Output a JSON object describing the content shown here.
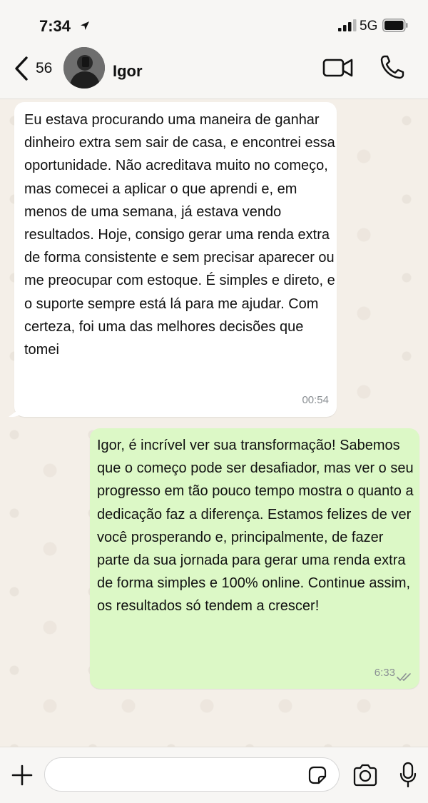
{
  "status_bar": {
    "time": "7:34",
    "network": "5G",
    "icons": [
      "location-arrow-icon",
      "signal-bars-icon",
      "battery-icon"
    ]
  },
  "header": {
    "back_count": "56",
    "contact_name": "Igor",
    "icons": [
      "chevron-left-icon",
      "video-camera-icon",
      "phone-icon"
    ]
  },
  "messages": [
    {
      "direction": "incoming",
      "text": "Eu estava procurando uma maneira de ganhar dinheiro extra sem sair de casa, e encontrei essa oportunidade. Não acreditava muito no começo, mas comecei a aplicar o que aprendi e, em menos de uma semana, já estava vendo resultados. Hoje, consigo gerar uma renda extra de forma consistente e sem precisar aparecer ou me preocupar com estoque. É simples e direto, e o suporte sempre está lá para me ajudar. Com certeza, foi uma das melhores decisões que tomei",
      "time": "00:54"
    },
    {
      "direction": "outgoing",
      "text": "Igor, é incrível ver sua transformação! Sabemos que o começo pode ser desafiador, mas ver o seu progresso em tão pouco tempo mostra o quanto a dedicação faz a diferença. Estamos felizes de ver você prosperando e, principalmente, de fazer parte da sua jornada para gerar uma renda extra de forma simples e 100% online. Continue assim, os resultados só tendem a crescer!",
      "time": "6:33",
      "status_icon": "double-check-icon"
    }
  ],
  "input_bar": {
    "placeholder": "",
    "icons": [
      "plus-icon",
      "sticker-icon",
      "camera-icon",
      "microphone-icon"
    ]
  },
  "colors": {
    "incoming_bubble": "#ffffff",
    "outgoing_bubble": "#dcf8c6",
    "chat_background": "#f4efe8",
    "timestamp": "#8a8f93"
  }
}
